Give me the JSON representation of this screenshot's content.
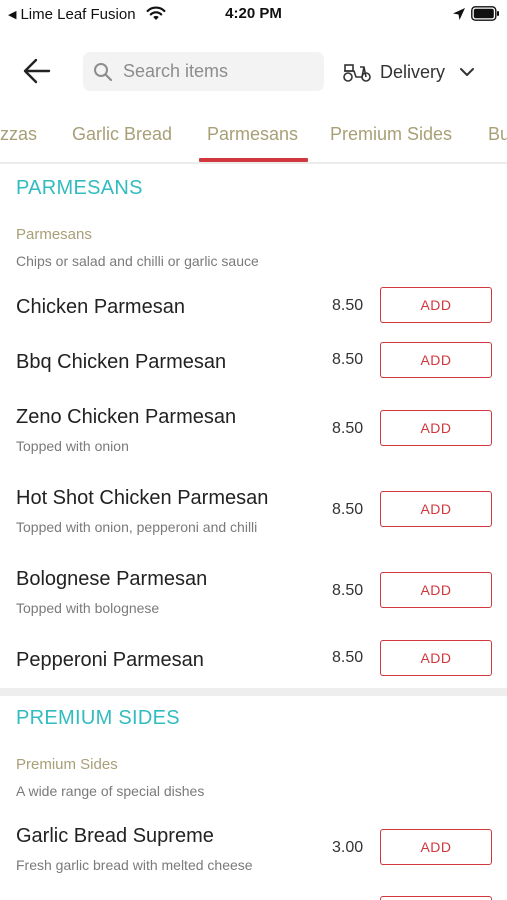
{
  "status_bar": {
    "back_app": "Lime Leaf Fusion",
    "time": "4:20 PM"
  },
  "header": {
    "search_placeholder": "Search items",
    "delivery_label": "Delivery"
  },
  "tabs": [
    {
      "label": "Pizzas"
    },
    {
      "label": "Garlic Bread"
    },
    {
      "label": "Parmesans",
      "active": true
    },
    {
      "label": "Premium Sides"
    },
    {
      "label": "Bu"
    }
  ],
  "colors": {
    "accent": "#d0383e",
    "section_title": "#31bcc0",
    "tab_text": "#a89f77"
  },
  "sections": [
    {
      "title": "PARMESANS",
      "subtitle": "Parmesans",
      "description": "Chips or salad and chilli or garlic sauce",
      "items": [
        {
          "name": "Chicken Parmesan",
          "desc": "",
          "price": "8.50",
          "button": "ADD"
        },
        {
          "name": "Bbq Chicken Parmesan",
          "desc": "",
          "price": "8.50",
          "button": "ADD"
        },
        {
          "name": "Zeno Chicken Parmesan",
          "desc": "Topped with onion",
          "price": "8.50",
          "button": "ADD"
        },
        {
          "name": "Hot Shot Chicken Parmesan",
          "desc": "Topped with onion, pepperoni and chilli",
          "price": "8.50",
          "button": "ADD"
        },
        {
          "name": "Bolognese Parmesan",
          "desc": "Topped with bolognese",
          "price": "8.50",
          "button": "ADD"
        },
        {
          "name": "Pepperoni Parmesan",
          "desc": "",
          "price": "8.50",
          "button": "ADD"
        }
      ]
    },
    {
      "title": "PREMIUM SIDES",
      "subtitle": "Premium Sides",
      "description": "A wide range of special dishes",
      "items": [
        {
          "name": "Garlic Bread Supreme",
          "desc": "Fresh garlic bread with melted cheese",
          "price": "3.00",
          "button": "ADD"
        }
      ]
    }
  ]
}
